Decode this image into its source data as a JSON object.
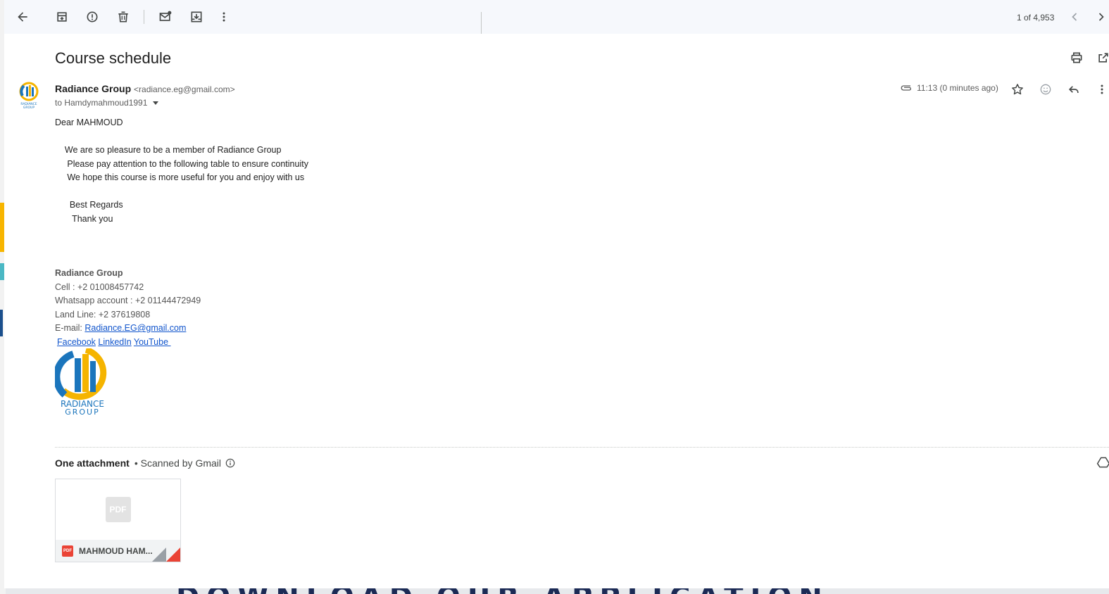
{
  "toolbar": {
    "back": "back-icon",
    "archive": "archive-icon",
    "spam": "report-spam-icon",
    "delete": "trash-icon",
    "mark_unread": "mark-unread-icon",
    "move": "move-to-icon",
    "more": "more-vert-icon",
    "pager": "1 of 4,953"
  },
  "email": {
    "subject": "Course schedule",
    "sender_name": "Radiance Group",
    "sender_email": "<radiance.eg@gmail.com>",
    "to": "to Hamdymahmoud1991",
    "time": "11:13 (0 minutes ago)",
    "body": {
      "greeting": "Dear MAHMOUD",
      "line1": "    We are so pleasure to be a member of Radiance Group",
      "line2": "     Please pay attention to the following table to ensure continuity",
      "line3": "     We hope this course is more useful for you and enjoy with us",
      "regards": "      Best Regards",
      "thanks": "       Thank you"
    },
    "signature": {
      "name": "Radiance Group",
      "cell": "Cell : +2 01008457742",
      "whatsapp": "Whatsapp account : +2 01144472949",
      "landline": "Land Line: +2 37619808",
      "email_label": "E-mail: ",
      "email_link": "Radiance.EG@gmail.com",
      "facebook": "Facebook",
      "linkedin": "LinkedIn",
      "youtube": "YouTube ",
      "logo_line1": "RADIANCE",
      "logo_line2": "GROUP"
    }
  },
  "attachments": {
    "heading": "One attachment",
    "scanned": "• Scanned by Gmail",
    "file_name": "MAHMOUD HAM...",
    "file_type": "PDF"
  },
  "colors": {
    "link": "#1155cc",
    "pdf_red": "#ea4335",
    "logo_blue": "#1b75bc",
    "logo_gold": "#f5b400"
  }
}
